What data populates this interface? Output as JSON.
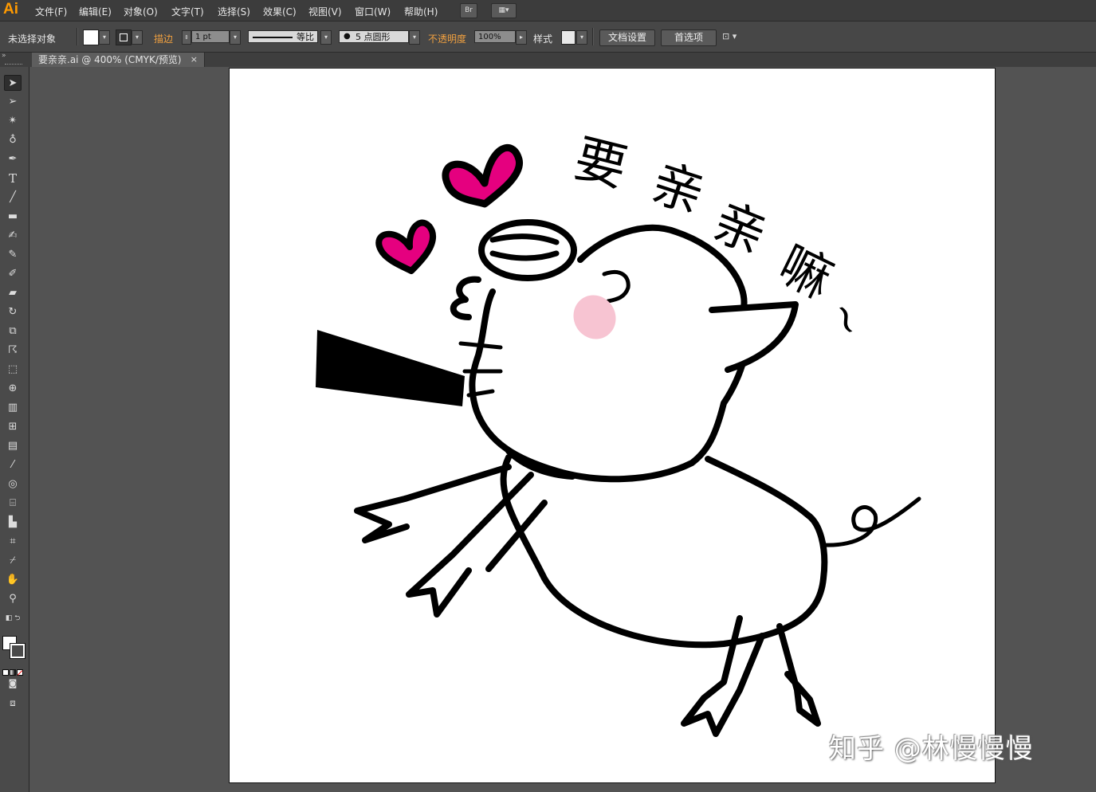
{
  "app": {
    "logo": "Ai"
  },
  "menu": {
    "items": [
      "文件(F)",
      "编辑(E)",
      "对象(O)",
      "文字(T)",
      "选择(S)",
      "效果(C)",
      "视图(V)",
      "窗口(W)",
      "帮助(H)"
    ],
    "bridge_label": "Br"
  },
  "control_bar": {
    "selection_status": "未选择对象",
    "stroke_label": "描边",
    "stroke_weight": "1 pt",
    "stroke_profile": "等比",
    "brush": "5 点圆形",
    "opacity_label": "不透明度",
    "opacity_value": "100%",
    "style_label": "样式",
    "doc_setup_button": "文档设置",
    "preferences_button": "首选项"
  },
  "document_tab": {
    "title": "要亲亲.ai @ 400% (CMYK/预览)",
    "close": "×"
  },
  "artwork": {
    "caption_chars": [
      "要",
      "亲",
      "亲",
      "嘛"
    ],
    "tilde": "~",
    "heart_color": "#e5007f",
    "blush_color": "#f7c4d2"
  },
  "watermark": "知乎 @林慢慢慢"
}
